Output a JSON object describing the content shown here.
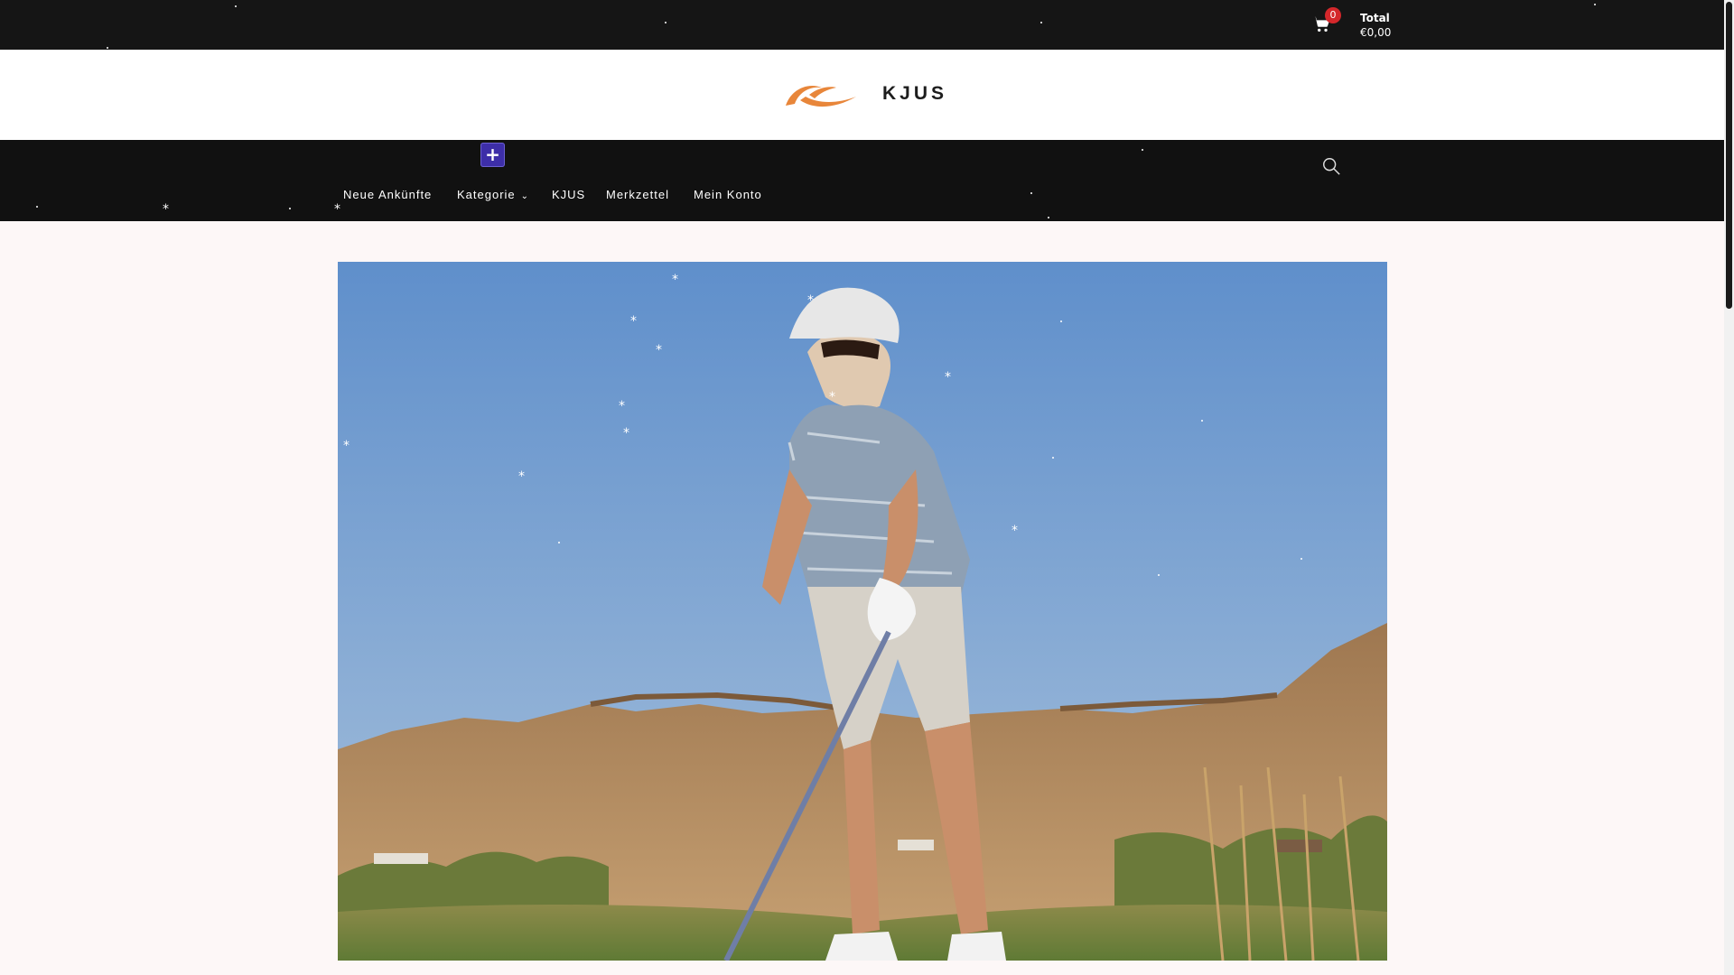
{
  "cart": {
    "count": "0",
    "total_label": "Total",
    "total_value": "€0,00",
    "icon": "shopping-cart-icon"
  },
  "brand": {
    "name": "KJUS",
    "logo_color": "#e8863a"
  },
  "nav": {
    "items": [
      {
        "label": "Neue Ankünfte"
      },
      {
        "label": "Kategorie"
      },
      {
        "label": "KJUS"
      },
      {
        "label": "Merkzettel"
      },
      {
        "label": "Mein Konto"
      }
    ],
    "plus_icon": "plus-icon",
    "search_icon": "search-icon"
  },
  "hero": {
    "image": "golfer-photo",
    "description_colors": {
      "sky": "#6e9acd",
      "hills": "#a47c51"
    }
  },
  "colors": {
    "topbar": "#151515",
    "navbar": "#111111",
    "badge": "#d4272b",
    "plus_button": "#3d2ea8",
    "page_bg": "#fdf7f7"
  }
}
